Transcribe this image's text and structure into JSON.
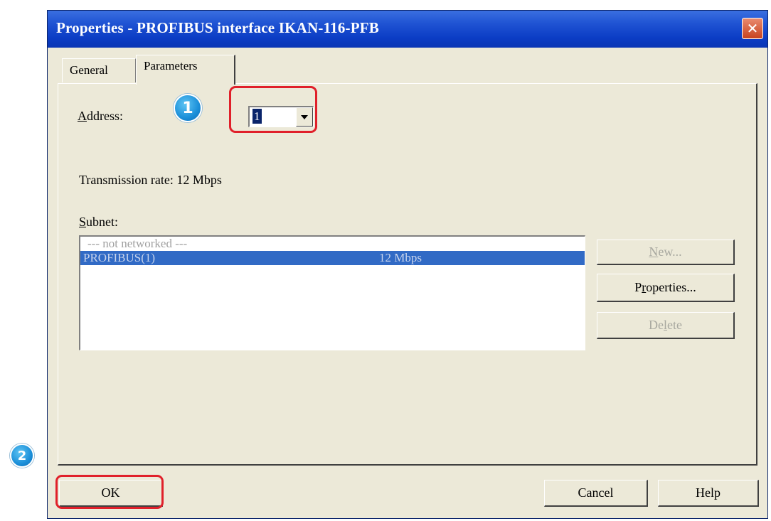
{
  "window": {
    "title": "Properties - PROFIBUS interface  IKAN-116-PFB",
    "close_symbol": "✕"
  },
  "tabs": [
    {
      "label": "General",
      "active": false
    },
    {
      "label": "Parameters",
      "active": true
    }
  ],
  "address": {
    "label_accel": "A",
    "label_rest": "ddress:",
    "value": "1"
  },
  "transmission_rate": "Transmission rate: 12 Mbps",
  "subnet": {
    "label_accel": "S",
    "label_rest": "ubnet:",
    "items": [
      {
        "name": "--- not networked ---",
        "rate": "",
        "selected": false
      },
      {
        "name": "PROFIBUS(1)",
        "rate": "12 Mbps",
        "selected": true
      }
    ]
  },
  "side_buttons": {
    "new_accel": "N",
    "new_rest": "ew...",
    "properties_pre": "P",
    "properties_accel": "r",
    "properties_rest": "operties...",
    "delete_pre": "De",
    "delete_accel": "l",
    "delete_rest": "ete"
  },
  "footer": {
    "ok": "OK",
    "cancel": "Cancel",
    "help": "Help"
  },
  "annotations": {
    "step1": "1",
    "step2": "2",
    "highlight_color": "#e0202a",
    "badge_color": "#1b8fd9"
  }
}
